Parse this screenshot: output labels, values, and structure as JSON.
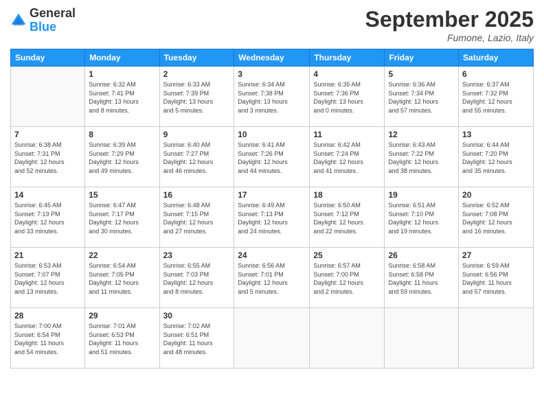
{
  "logo": {
    "line1": "General",
    "line2": "Blue"
  },
  "title": "September 2025",
  "location": "Fumone, Lazio, Italy",
  "weekdays": [
    "Sunday",
    "Monday",
    "Tuesday",
    "Wednesday",
    "Thursday",
    "Friday",
    "Saturday"
  ],
  "weeks": [
    [
      {
        "day": "",
        "info": ""
      },
      {
        "day": "1",
        "info": "Sunrise: 6:32 AM\nSunset: 7:41 PM\nDaylight: 13 hours\nand 8 minutes."
      },
      {
        "day": "2",
        "info": "Sunrise: 6:33 AM\nSunset: 7:39 PM\nDaylight: 13 hours\nand 5 minutes."
      },
      {
        "day": "3",
        "info": "Sunrise: 6:34 AM\nSunset: 7:38 PM\nDaylight: 13 hours\nand 3 minutes."
      },
      {
        "day": "4",
        "info": "Sunrise: 6:35 AM\nSunset: 7:36 PM\nDaylight: 13 hours\nand 0 minutes."
      },
      {
        "day": "5",
        "info": "Sunrise: 6:36 AM\nSunset: 7:34 PM\nDaylight: 12 hours\nand 57 minutes."
      },
      {
        "day": "6",
        "info": "Sunrise: 6:37 AM\nSunset: 7:32 PM\nDaylight: 12 hours\nand 55 minutes."
      }
    ],
    [
      {
        "day": "7",
        "info": "Sunrise: 6:38 AM\nSunset: 7:31 PM\nDaylight: 12 hours\nand 52 minutes."
      },
      {
        "day": "8",
        "info": "Sunrise: 6:39 AM\nSunset: 7:29 PM\nDaylight: 12 hours\nand 49 minutes."
      },
      {
        "day": "9",
        "info": "Sunrise: 6:40 AM\nSunset: 7:27 PM\nDaylight: 12 hours\nand 46 minutes."
      },
      {
        "day": "10",
        "info": "Sunrise: 6:41 AM\nSunset: 7:26 PM\nDaylight: 12 hours\nand 44 minutes."
      },
      {
        "day": "11",
        "info": "Sunrise: 6:42 AM\nSunset: 7:24 PM\nDaylight: 12 hours\nand 41 minutes."
      },
      {
        "day": "12",
        "info": "Sunrise: 6:43 AM\nSunset: 7:22 PM\nDaylight: 12 hours\nand 38 minutes."
      },
      {
        "day": "13",
        "info": "Sunrise: 6:44 AM\nSunset: 7:20 PM\nDaylight: 12 hours\nand 35 minutes."
      }
    ],
    [
      {
        "day": "14",
        "info": "Sunrise: 6:45 AM\nSunset: 7:19 PM\nDaylight: 12 hours\nand 33 minutes."
      },
      {
        "day": "15",
        "info": "Sunrise: 6:47 AM\nSunset: 7:17 PM\nDaylight: 12 hours\nand 30 minutes."
      },
      {
        "day": "16",
        "info": "Sunrise: 6:48 AM\nSunset: 7:15 PM\nDaylight: 12 hours\nand 27 minutes."
      },
      {
        "day": "17",
        "info": "Sunrise: 6:49 AM\nSunset: 7:13 PM\nDaylight: 12 hours\nand 24 minutes."
      },
      {
        "day": "18",
        "info": "Sunrise: 6:50 AM\nSunset: 7:12 PM\nDaylight: 12 hours\nand 22 minutes."
      },
      {
        "day": "19",
        "info": "Sunrise: 6:51 AM\nSunset: 7:10 PM\nDaylight: 12 hours\nand 19 minutes."
      },
      {
        "day": "20",
        "info": "Sunrise: 6:52 AM\nSunset: 7:08 PM\nDaylight: 12 hours\nand 16 minutes."
      }
    ],
    [
      {
        "day": "21",
        "info": "Sunrise: 6:53 AM\nSunset: 7:07 PM\nDaylight: 12 hours\nand 13 minutes."
      },
      {
        "day": "22",
        "info": "Sunrise: 6:54 AM\nSunset: 7:05 PM\nDaylight: 12 hours\nand 11 minutes."
      },
      {
        "day": "23",
        "info": "Sunrise: 6:55 AM\nSunset: 7:03 PM\nDaylight: 12 hours\nand 8 minutes."
      },
      {
        "day": "24",
        "info": "Sunrise: 6:56 AM\nSunset: 7:01 PM\nDaylight: 12 hours\nand 5 minutes."
      },
      {
        "day": "25",
        "info": "Sunrise: 6:57 AM\nSunset: 7:00 PM\nDaylight: 12 hours\nand 2 minutes."
      },
      {
        "day": "26",
        "info": "Sunrise: 6:58 AM\nSunset: 6:58 PM\nDaylight: 11 hours\nand 59 minutes."
      },
      {
        "day": "27",
        "info": "Sunrise: 6:59 AM\nSunset: 6:56 PM\nDaylight: 11 hours\nand 57 minutes."
      }
    ],
    [
      {
        "day": "28",
        "info": "Sunrise: 7:00 AM\nSunset: 6:54 PM\nDaylight: 11 hours\nand 54 minutes."
      },
      {
        "day": "29",
        "info": "Sunrise: 7:01 AM\nSunset: 6:53 PM\nDaylight: 11 hours\nand 51 minutes."
      },
      {
        "day": "30",
        "info": "Sunrise: 7:02 AM\nSunset: 6:51 PM\nDaylight: 11 hours\nand 48 minutes."
      },
      {
        "day": "",
        "info": ""
      },
      {
        "day": "",
        "info": ""
      },
      {
        "day": "",
        "info": ""
      },
      {
        "day": "",
        "info": ""
      }
    ]
  ]
}
